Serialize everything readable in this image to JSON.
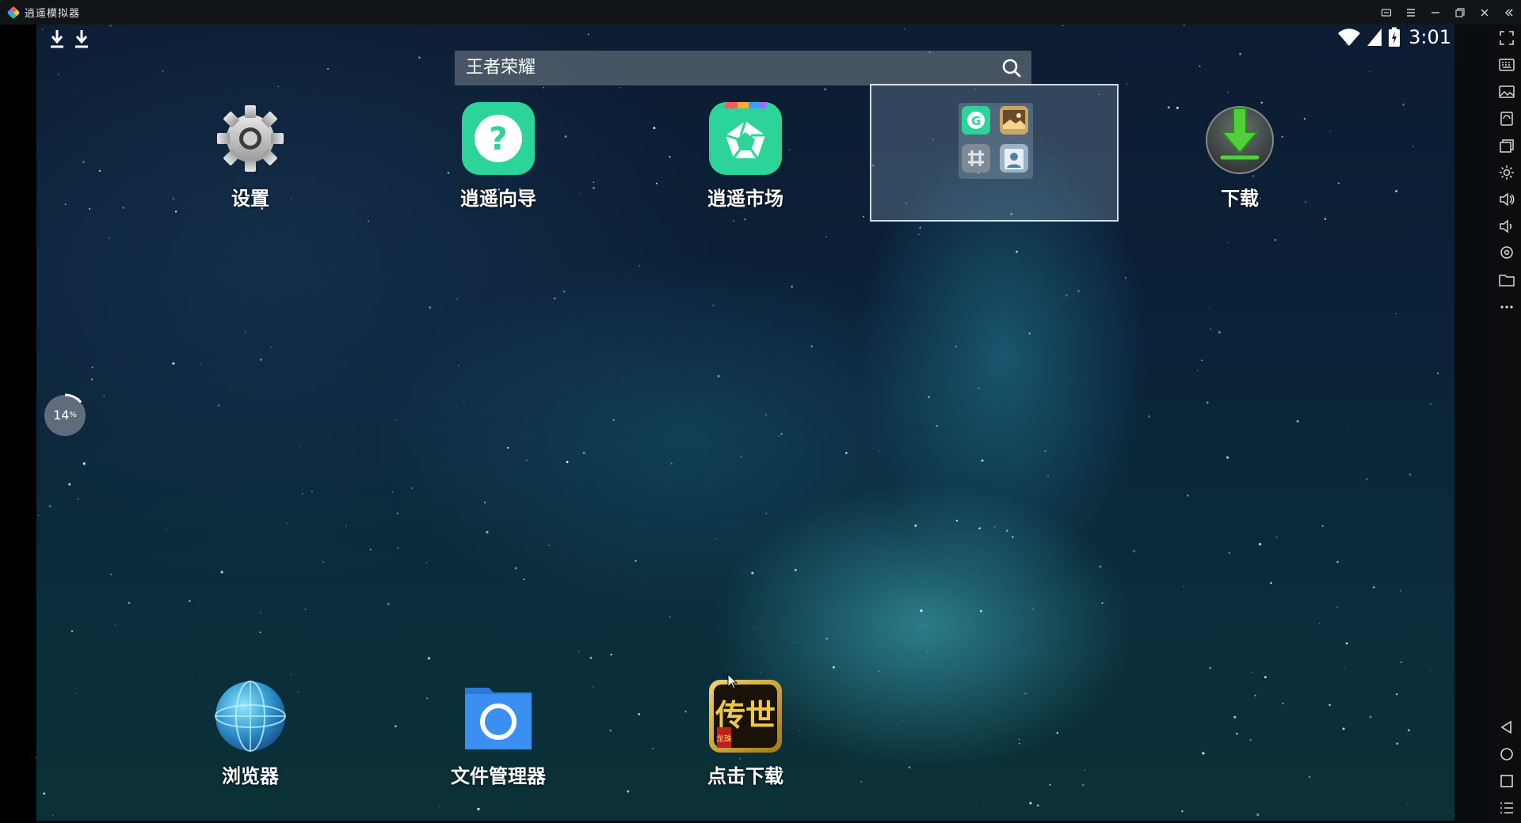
{
  "window": {
    "title": "逍遥模拟器"
  },
  "status_bar": {
    "time": "3:01"
  },
  "search": {
    "text": "王者荣耀"
  },
  "desktop": {
    "top_row": [
      {
        "label": "设置",
        "icon": "gear-icon"
      },
      {
        "label": "逍遥向导",
        "icon": "help-icon"
      },
      {
        "label": "逍遥市场",
        "icon": "market-icon"
      },
      {
        "label": "下载",
        "icon": "download-icon"
      }
    ],
    "bottom_row": [
      {
        "label": "浏览器",
        "icon": "globe-icon"
      },
      {
        "label": "文件管理器",
        "icon": "folder-icon"
      },
      {
        "label": "点击下载",
        "icon": "game-icon",
        "game_text": "传世",
        "game_subtext": "龙珠"
      }
    ],
    "folder": {
      "apps": [
        "google-icon",
        "gallery-icon",
        "calculator-icon",
        "contacts-icon"
      ]
    }
  },
  "progress": {
    "value": "14",
    "unit": "%"
  },
  "colors": {
    "accent_green": "#2dd49a",
    "titlebar_bg": "#121518",
    "toolbar_bg": "#0b0d0f"
  }
}
